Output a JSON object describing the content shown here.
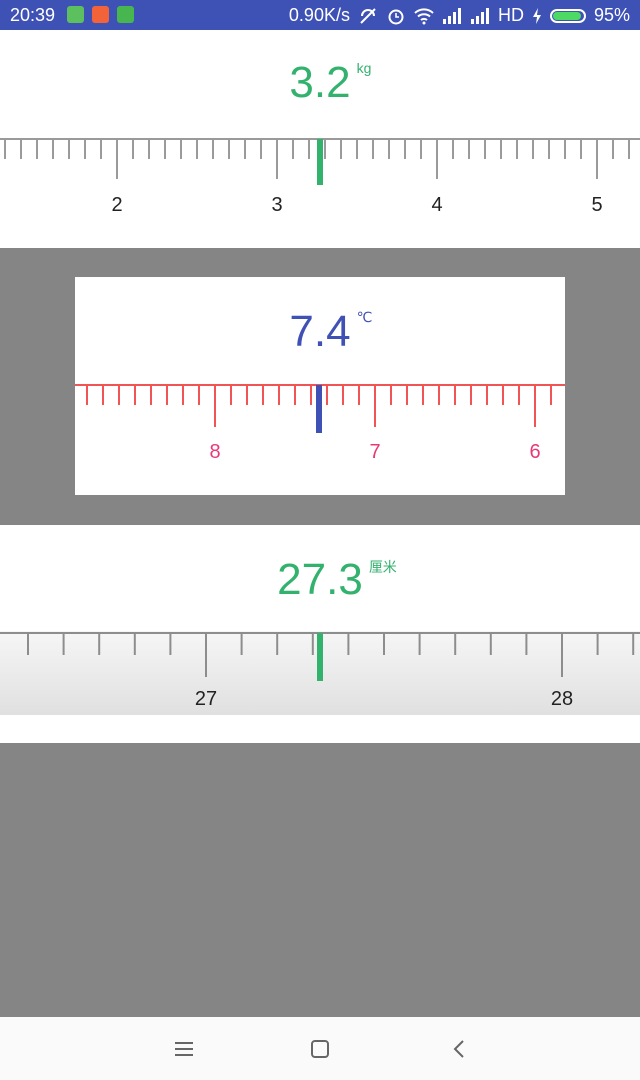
{
  "status_bar": {
    "time": "20:39",
    "network_speed": "0.90K/s",
    "network_type": "HD",
    "battery": "95%",
    "battery_level": 0.95,
    "icons": [
      "app-notification-icon",
      "shield-app-icon",
      "android-app-icon",
      "silent-icon",
      "alarm-icon",
      "wifi-icon",
      "signal-icon",
      "signal-icon",
      "charging-icon",
      "battery-icon"
    ]
  },
  "weight_ruler": {
    "value": "3.2",
    "unit": "kg",
    "labels": [
      "2",
      "3",
      "4",
      "5"
    ],
    "color": "#33b26e",
    "tick_color": "#9a9a9a",
    "label_color": "#222222"
  },
  "temperature_ruler": {
    "value": "7.4",
    "unit": "℃",
    "labels": [
      "8",
      "7",
      "6"
    ],
    "color": "#3f51b5",
    "tick_color": "#f05454",
    "label_color": "#e83878"
  },
  "length_ruler": {
    "value": "27.3",
    "unit": "厘米",
    "labels": [
      "27",
      "28"
    ],
    "color": "#33b26e",
    "tick_color": "#8d8d8d",
    "label_color": "#222222"
  },
  "nav_bar": {
    "icons": [
      "menu-icon",
      "home-icon",
      "back-icon"
    ]
  }
}
